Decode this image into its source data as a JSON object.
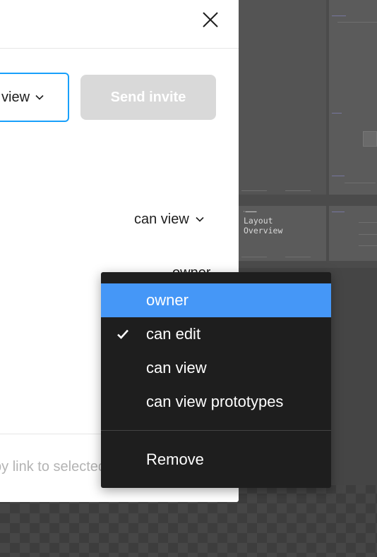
{
  "modal": {
    "permission_select": {
      "label": "view"
    },
    "send_button": {
      "label": "Send invite"
    },
    "member": {
      "permission_label": "can view"
    },
    "peek_label": "owner",
    "copy_link_label": "Copy link to selected"
  },
  "dropdown": {
    "items": [
      {
        "label": "owner",
        "highlighted": true,
        "checked": false
      },
      {
        "label": "can edit",
        "highlighted": false,
        "checked": true
      },
      {
        "label": "can view",
        "highlighted": false,
        "checked": false
      },
      {
        "label": "can view prototypes",
        "highlighted": false,
        "checked": false
      }
    ],
    "remove_label": "Remove"
  },
  "canvas": {
    "frame_title": "Layout\nOverview"
  },
  "colors": {
    "accent": "#18a0fb",
    "menu_highlight": "#4597f7",
    "menu_bg": "#1e1e1e",
    "disabled_button": "#d9d9d9"
  }
}
